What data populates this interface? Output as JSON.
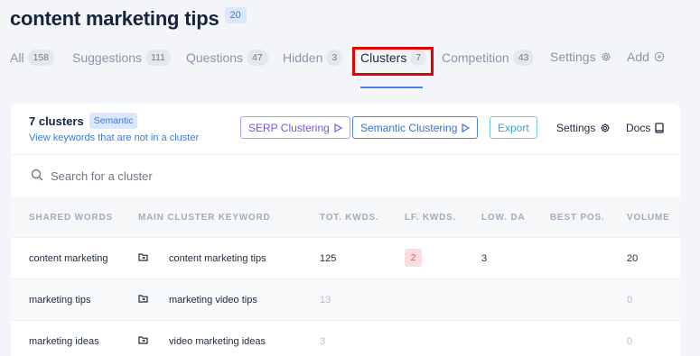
{
  "header": {
    "title": "content marketing tips",
    "badge": "20"
  },
  "tabs": [
    {
      "label": "All",
      "count": "158"
    },
    {
      "label": "Suggestions",
      "count": "111"
    },
    {
      "label": "Questions",
      "count": "47"
    },
    {
      "label": "Hidden",
      "count": "3"
    },
    {
      "label": "Clusters",
      "count": "7",
      "active": true
    },
    {
      "label": "Competition",
      "count": "43"
    },
    {
      "label": "Settings",
      "icon": "gear-icon"
    },
    {
      "label": "Add",
      "icon": "plus-circle-icon"
    }
  ],
  "clusters": {
    "count_label": "7 clusters",
    "mode_badge": "Semantic",
    "link": "View keywords that are not in a cluster",
    "buttons": {
      "serp": "SERP Clustering",
      "semantic": "Semantic Clustering",
      "export": "Export",
      "settings": "Settings",
      "docs": "Docs"
    }
  },
  "search": {
    "placeholder": "Search for a cluster"
  },
  "table": {
    "columns": [
      "SHARED WORDS",
      "MAIN CLUSTER KEYWORD",
      "TOT. KWDS.",
      "LF. KWDS.",
      "LOW. DA",
      "BEST POS.",
      "VOLUME"
    ],
    "rows": [
      {
        "shared": "content marketing",
        "main": "content marketing tips",
        "tot": "125",
        "lf": "2",
        "low_da": "3",
        "best_pos": "",
        "volume": "20"
      },
      {
        "shared": "marketing tips",
        "main": "marketing video tips",
        "tot": "13",
        "lf": "",
        "low_da": "",
        "best_pos": "",
        "volume": "0"
      },
      {
        "shared": "marketing ideas",
        "main": "video marketing ideas",
        "tot": "3",
        "lf": "",
        "low_da": "",
        "best_pos": "",
        "volume": "0"
      }
    ]
  },
  "colors": {
    "accent": "#4a86e8",
    "highlight": "#e30000",
    "serp": "#7a52e0",
    "export": "#3aa5c6",
    "lf_badge_bg": "#fbdde0"
  }
}
